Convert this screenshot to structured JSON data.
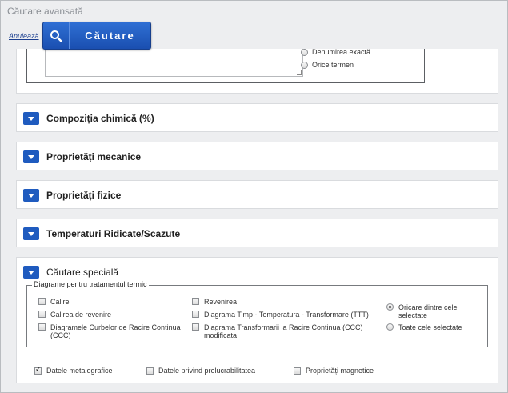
{
  "page": {
    "title": "Căutare avansată"
  },
  "toolbar": {
    "cancel_label": "Anulează",
    "search_label": "Căutare"
  },
  "top_panel": {
    "radio_options": [
      {
        "label": "Denumirea exactă",
        "checked": false
      },
      {
        "label": "Orice termen",
        "checked": false
      }
    ]
  },
  "accordions": [
    {
      "title": "Compoziția chimică (%)"
    },
    {
      "title": "Proprietăți mecanice"
    },
    {
      "title": "Proprietăți fizice"
    },
    {
      "title": "Temperaturi Ridicate/Scazute"
    }
  ],
  "special_search": {
    "title": "Căutare specială",
    "legend": "Diagrame pentru tratamentul termic",
    "checkbox_col1": [
      "Calire",
      "Calirea de revenire",
      "Diagramele Curbelor de Racire Continua (CCC)"
    ],
    "checkbox_col2": [
      "Revenirea",
      "Diagrama Timp - Temperatura - Transformare (TTT)",
      "Diagrama Transformarii la Racire Continua (CCC) modificata"
    ],
    "match_options": [
      {
        "label": "Oricare dintre cele selectate",
        "checked": true
      },
      {
        "label": "Toate cele selectate",
        "checked": false
      }
    ],
    "bottom_checkboxes": [
      {
        "label": "Datele metalografice",
        "checked": true
      },
      {
        "label": "Datele privind prelucrabilitatea",
        "checked": false
      },
      {
        "label": "Proprietăți magnetice",
        "checked": false
      }
    ]
  },
  "icons": {
    "search": "search-icon",
    "expand": "chevron-down-icon"
  },
  "colors": {
    "accent": "#1f5bbf",
    "button_top": "#2f6fd4",
    "button_bottom": "#1a4fb0",
    "link": "#1b3e8f"
  }
}
